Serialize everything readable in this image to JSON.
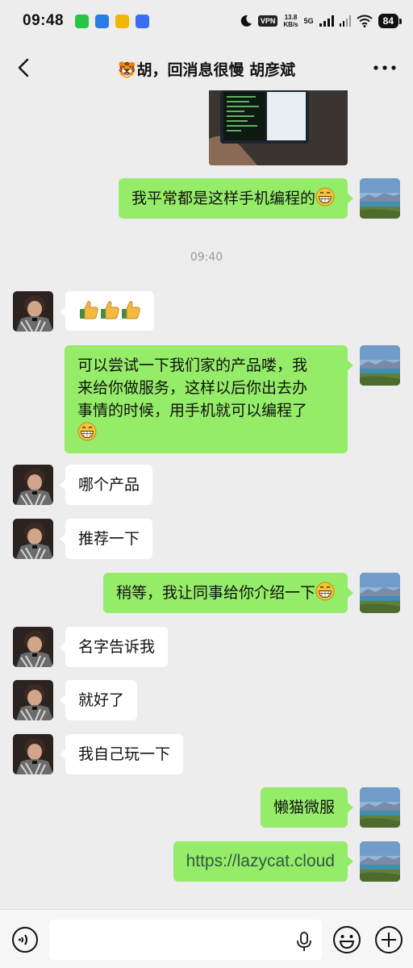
{
  "status_bar": {
    "time": "09:48",
    "vpn": "VPN",
    "speed_value": "13.8",
    "speed_unit": "KB/s",
    "network": "5G",
    "battery": "84"
  },
  "header": {
    "title": "🐯胡，回消息很慢 胡彦斌"
  },
  "chat": {
    "timestamp": "09:40",
    "messages": [
      {
        "from": "me",
        "text": "我平常都是这样手机编程的"
      },
      {
        "from": "other",
        "text": "👍👍👍"
      },
      {
        "from": "me",
        "line1": "可以尝试一下我们家的产品喽，我",
        "line2": "来给你做服务，这样以后你出去办",
        "line3": "事情的时候，用手机就可以编程了"
      },
      {
        "from": "other",
        "text": "哪个产品"
      },
      {
        "from": "other",
        "text": "推荐一下"
      },
      {
        "from": "me",
        "text": "稍等，我让同事给你介绍一下"
      },
      {
        "from": "other",
        "text": "名字告诉我"
      },
      {
        "from": "other",
        "text": "就好了"
      },
      {
        "from": "other",
        "text": "我自己玩一下"
      },
      {
        "from": "me",
        "text": "懒猫微服"
      },
      {
        "from": "me",
        "text": "https://lazycat.cloud"
      }
    ]
  },
  "input": {
    "placeholder": ""
  },
  "colors": {
    "background": "#ededed",
    "my_bubble": "#95ec69",
    "their_bubble": "#ffffff",
    "link": "#2f5a3f"
  },
  "icons": [
    "back-arrow-icon",
    "more-icon",
    "voice-icon",
    "mic-icon",
    "emoji-icon",
    "plus-icon",
    "grin-emoji-icon",
    "thumbs-up-icon"
  ]
}
